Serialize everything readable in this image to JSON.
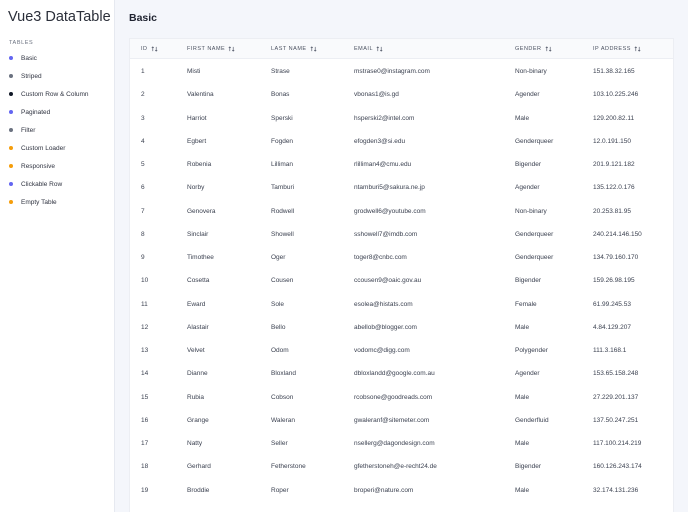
{
  "app": {
    "title": "Vue3 DataTable"
  },
  "sidebar": {
    "section_label": "TABLES",
    "items": [
      {
        "label": "Basic",
        "color": "#6366f1"
      },
      {
        "label": "Striped",
        "color": "#6b7280"
      },
      {
        "label": "Custom Row & Column",
        "color": "#111827"
      },
      {
        "label": "Paginated",
        "color": "#6366f1"
      },
      {
        "label": "Filter",
        "color": "#6b7280"
      },
      {
        "label": "Custom Loader",
        "color": "#f59e0b"
      },
      {
        "label": "Responsive",
        "color": "#f59e0b"
      },
      {
        "label": "Clickable Row",
        "color": "#6366f1"
      },
      {
        "label": "Empty Table",
        "color": "#f59e0b"
      }
    ]
  },
  "page": {
    "title": "Basic"
  },
  "table": {
    "columns": [
      "ID",
      "FIRST NAME",
      "LAST NAME",
      "EMAIL",
      "GENDER",
      "IP ADDRESS"
    ],
    "rows": [
      [
        "1",
        "Misti",
        "Strase",
        "mstrase0@instagram.com",
        "Non-binary",
        "151.38.32.165"
      ],
      [
        "2",
        "Valentina",
        "Bonas",
        "vbonas1@is.gd",
        "Agender",
        "103.10.225.246"
      ],
      [
        "3",
        "Harriot",
        "Sperski",
        "hsperski2@intel.com",
        "Male",
        "129.200.82.11"
      ],
      [
        "4",
        "Egbert",
        "Fogden",
        "efogden3@si.edu",
        "Genderqueer",
        "12.0.191.150"
      ],
      [
        "5",
        "Robenia",
        "Lilliman",
        "rlilliman4@cmu.edu",
        "Bigender",
        "201.9.121.182"
      ],
      [
        "6",
        "Norby",
        "Tamburi",
        "ntamburi5@sakura.ne.jp",
        "Agender",
        "135.122.0.176"
      ],
      [
        "7",
        "Genovera",
        "Rodwell",
        "grodwell6@youtube.com",
        "Non-binary",
        "20.253.81.95"
      ],
      [
        "8",
        "Sinclair",
        "Showell",
        "sshowell7@imdb.com",
        "Genderqueer",
        "240.214.146.150"
      ],
      [
        "9",
        "Timothee",
        "Oger",
        "toger8@cnbc.com",
        "Genderqueer",
        "134.79.160.170"
      ],
      [
        "10",
        "Cosetta",
        "Cousen",
        "ccousen9@oaic.gov.au",
        "Bigender",
        "159.26.98.195"
      ],
      [
        "11",
        "Eward",
        "Sole",
        "esolea@histats.com",
        "Female",
        "61.99.245.53"
      ],
      [
        "12",
        "Alastair",
        "Bello",
        "abellob@blogger.com",
        "Male",
        "4.84.129.207"
      ],
      [
        "13",
        "Velvet",
        "Odom",
        "vodomc@digg.com",
        "Polygender",
        "111.3.168.1"
      ],
      [
        "14",
        "Dianne",
        "Bloxland",
        "dbloxlandd@google.com.au",
        "Agender",
        "153.65.158.248"
      ],
      [
        "15",
        "Rubia",
        "Cobson",
        "rcobsone@goodreads.com",
        "Male",
        "27.229.201.137"
      ],
      [
        "16",
        "Grange",
        "Waleran",
        "gwaleranf@sitemeter.com",
        "Genderfluid",
        "137.50.247.251"
      ],
      [
        "17",
        "Natty",
        "Seller",
        "nsellerg@dagondesign.com",
        "Male",
        "117.100.214.219"
      ],
      [
        "18",
        "Gerhard",
        "Fetherstone",
        "gfetherstoneh@e-recht24.de",
        "Bigender",
        "160.126.243.174"
      ],
      [
        "19",
        "Broddie",
        "Roper",
        "broperi@nature.com",
        "Male",
        "32.174.131.236"
      ]
    ]
  }
}
